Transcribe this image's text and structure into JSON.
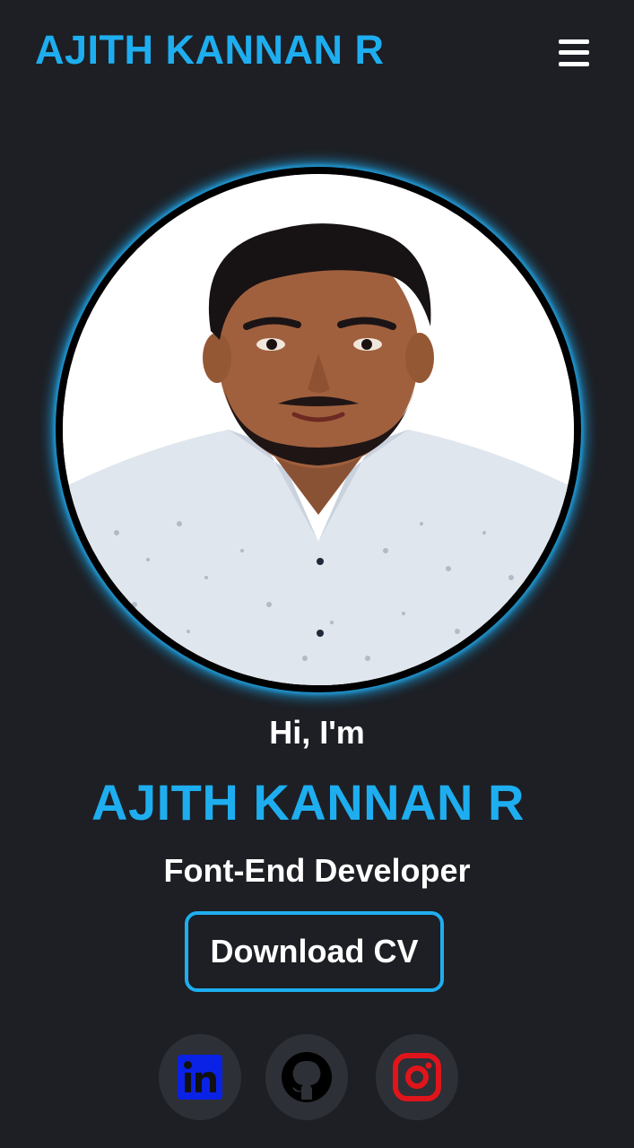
{
  "header": {
    "brand": "AJITH KANNAN R",
    "menu_icon": "hamburger-menu-icon"
  },
  "hero": {
    "photo": "profile-photo",
    "greeting": "Hi, I'm",
    "name": "AJITH KANNAN R",
    "role": "Font-End Developer",
    "cv_button": "Download CV"
  },
  "social": [
    {
      "icon": "linkedin-icon",
      "color": "#0a22e6"
    },
    {
      "icon": "github-icon",
      "color": "#000000"
    },
    {
      "icon": "instagram-icon",
      "color": "#e0151b"
    }
  ],
  "colors": {
    "accent": "#1eaef0",
    "background": "#1d1f24",
    "social_bg": "#2d3036"
  }
}
